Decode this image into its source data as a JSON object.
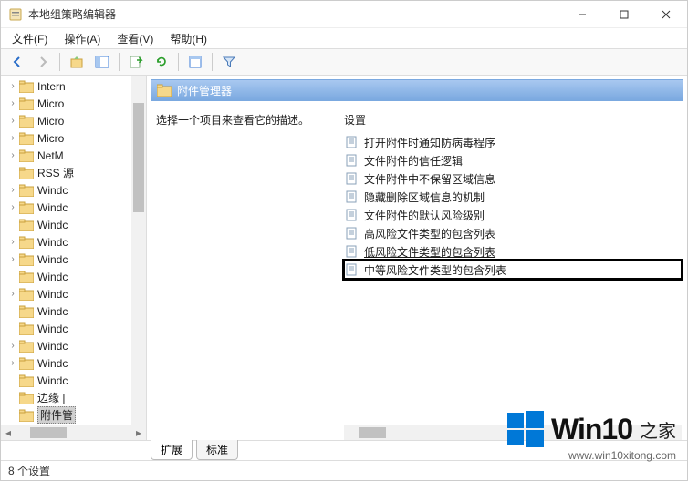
{
  "window": {
    "title": "本地组策略编辑器"
  },
  "menu": {
    "file": "文件(F)",
    "action": "操作(A)",
    "view": "查看(V)",
    "help": "帮助(H)"
  },
  "tree": {
    "items": [
      {
        "label": "Intern",
        "exp": ">"
      },
      {
        "label": "Micro",
        "exp": ">"
      },
      {
        "label": "Micro",
        "exp": ">"
      },
      {
        "label": "Micro",
        "exp": ">"
      },
      {
        "label": "NetM",
        "exp": ">"
      },
      {
        "label": "RSS 源",
        "exp": " "
      },
      {
        "label": "Windc",
        "exp": ">"
      },
      {
        "label": "Windc",
        "exp": ">"
      },
      {
        "label": "Windc",
        "exp": " "
      },
      {
        "label": "Windc",
        "exp": ">"
      },
      {
        "label": "Windc",
        "exp": ">"
      },
      {
        "label": "Windc",
        "exp": " "
      },
      {
        "label": "Windc",
        "exp": ">"
      },
      {
        "label": "Windc",
        "exp": " "
      },
      {
        "label": "Windc",
        "exp": " "
      },
      {
        "label": "Windc",
        "exp": ">"
      },
      {
        "label": "Windc",
        "exp": ">"
      },
      {
        "label": "Windc",
        "exp": " "
      },
      {
        "label": "边缘 |",
        "exp": " "
      },
      {
        "label": "附件管",
        "exp": " ",
        "selected": true
      }
    ]
  },
  "content": {
    "header": "附件管理器",
    "desc": "选择一个项目来查看它的描述。",
    "list_header": "设置",
    "settings": [
      "打开附件时通知防病毒程序",
      "文件附件的信任逻辑",
      "文件附件中不保留区域信息",
      "隐藏删除区域信息的机制",
      "文件附件的默认风险级别",
      "高风险文件类型的包含列表",
      "低风险文件类型的包含列表",
      "中等风险文件类型的包含列表"
    ]
  },
  "tabs": {
    "extended": "扩展",
    "standard": "标准"
  },
  "status": "8 个设置",
  "watermark": {
    "brand": "Win10",
    "sub": "之家",
    "url": "www.win10xitong.com"
  }
}
